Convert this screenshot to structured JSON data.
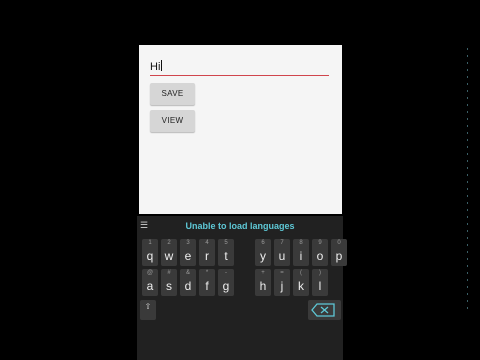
{
  "field": {
    "value": "Hi"
  },
  "buttons": {
    "save": "SAVE",
    "view": "VIEW"
  },
  "keyboard": {
    "menu_icon": "hamburger-menu-icon",
    "status": "Unable to load languages",
    "row1": [
      {
        "sub": "1",
        "key": "q"
      },
      {
        "sub": "2",
        "key": "w"
      },
      {
        "sub": "3",
        "key": "e"
      },
      {
        "sub": "4",
        "key": "r"
      },
      {
        "sub": "5",
        "key": "t"
      },
      {
        "sub": "6",
        "key": "y"
      },
      {
        "sub": "7",
        "key": "u"
      },
      {
        "sub": "8",
        "key": "i"
      },
      {
        "sub": "9",
        "key": "o"
      },
      {
        "sub": "0",
        "key": "p"
      }
    ],
    "row2": [
      {
        "sub": "@",
        "key": "a"
      },
      {
        "sub": "#",
        "key": "s"
      },
      {
        "sub": "&",
        "key": "d"
      },
      {
        "sub": "*",
        "key": "f"
      },
      {
        "sub": "-",
        "key": "g"
      },
      {
        "sub": "+",
        "key": "h"
      },
      {
        "sub": "=",
        "key": "j"
      },
      {
        "sub": "(",
        "key": "k"
      },
      {
        "sub": ")",
        "key": "l"
      }
    ],
    "shift_icon": "shift-icon",
    "backspace_icon": "backspace-icon"
  }
}
